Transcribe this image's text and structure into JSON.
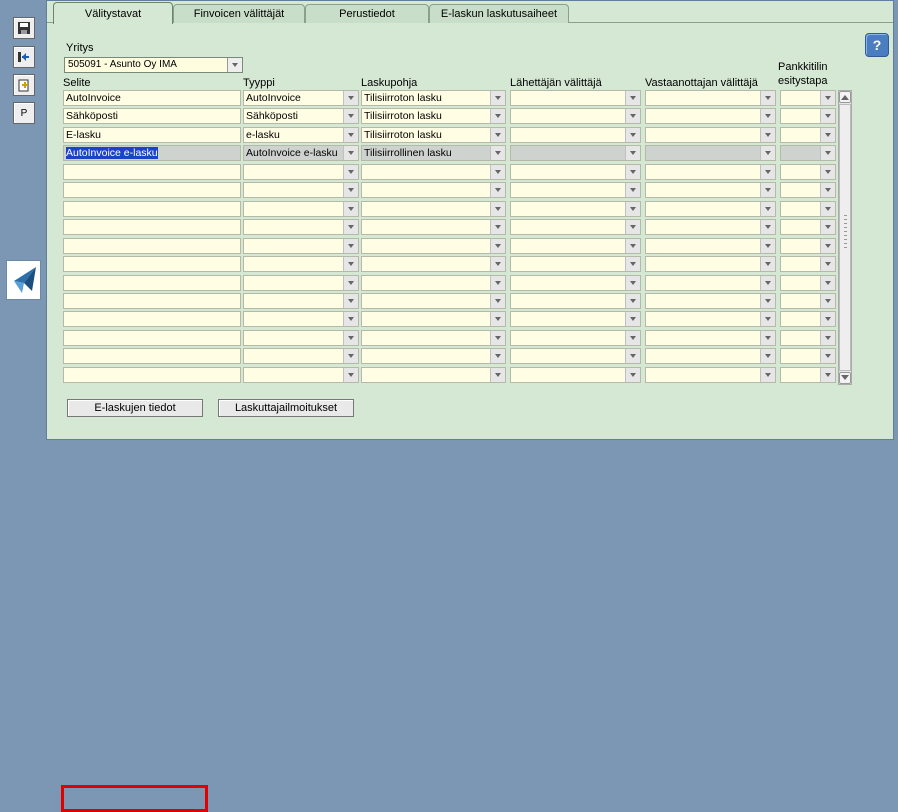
{
  "toolbar": {
    "buttons": [
      {
        "name": "save-icon"
      },
      {
        "name": "exit-icon"
      },
      {
        "name": "new-document-icon"
      },
      {
        "name": "p-button",
        "label": "P"
      }
    ],
    "logo": "app-logo-icon"
  },
  "tabs": [
    {
      "label": "Välitystavat",
      "active": true
    },
    {
      "label": "Finvoicen välittäjät",
      "active": false
    },
    {
      "label": "Perustiedot",
      "active": false
    },
    {
      "label": "E-laskun laskutusaiheet",
      "active": false
    }
  ],
  "help_label": "?",
  "yritys": {
    "label": "Yritys",
    "value": "505091 - Asunto Oy IMA"
  },
  "columns": {
    "selite": "Selite",
    "tyyppi": "Tyyppi",
    "laskupohja": "Laskupohja",
    "lahettaja": "Lähettäjän välittäjä",
    "vastaanottaja": "Vastaanottajan välittäjä",
    "pankkitili_line1": "Pankkitilin",
    "pankkitili_line2": "esitystapa"
  },
  "rows": [
    {
      "selite": "AutoInvoice",
      "tyyppi": "AutoInvoice",
      "laskupohja": "Tilisiirroton lasku",
      "lahettaja": "",
      "vastaanottaja": "",
      "pankkitili": ""
    },
    {
      "selite": "Sähköposti",
      "tyyppi": "Sähköposti",
      "laskupohja": "Tilisiirroton lasku",
      "lahettaja": "",
      "vastaanottaja": "",
      "pankkitili": ""
    },
    {
      "selite": "E-lasku",
      "tyyppi": "e-lasku",
      "laskupohja": "Tilisiirroton lasku",
      "lahettaja": "",
      "vastaanottaja": "",
      "pankkitili": ""
    },
    {
      "selite": "AutoInvoice e-lasku",
      "tyyppi": "AutoInvoice e-lasku",
      "laskupohja": "Tilisiirrollinen lasku",
      "lahettaja": "",
      "vastaanottaja": "",
      "pankkitili": ""
    },
    {
      "selite": "",
      "tyyppi": "",
      "laskupohja": "",
      "lahettaja": "",
      "vastaanottaja": "",
      "pankkitili": ""
    },
    {
      "selite": "",
      "tyyppi": "",
      "laskupohja": "",
      "lahettaja": "",
      "vastaanottaja": "",
      "pankkitili": ""
    },
    {
      "selite": "",
      "tyyppi": "",
      "laskupohja": "",
      "lahettaja": "",
      "vastaanottaja": "",
      "pankkitili": ""
    },
    {
      "selite": "",
      "tyyppi": "",
      "laskupohja": "",
      "lahettaja": "",
      "vastaanottaja": "",
      "pankkitili": ""
    },
    {
      "selite": "",
      "tyyppi": "",
      "laskupohja": "",
      "lahettaja": "",
      "vastaanottaja": "",
      "pankkitili": ""
    },
    {
      "selite": "",
      "tyyppi": "",
      "laskupohja": "",
      "lahettaja": "",
      "vastaanottaja": "",
      "pankkitili": ""
    },
    {
      "selite": "",
      "tyyppi": "",
      "laskupohja": "",
      "lahettaja": "",
      "vastaanottaja": "",
      "pankkitili": ""
    },
    {
      "selite": "",
      "tyyppi": "",
      "laskupohja": "",
      "lahettaja": "",
      "vastaanottaja": "",
      "pankkitili": ""
    },
    {
      "selite": "",
      "tyyppi": "",
      "laskupohja": "",
      "lahettaja": "",
      "vastaanottaja": "",
      "pankkitili": ""
    },
    {
      "selite": "",
      "tyyppi": "",
      "laskupohja": "",
      "lahettaja": "",
      "vastaanottaja": "",
      "pankkitili": ""
    },
    {
      "selite": "",
      "tyyppi": "",
      "laskupohja": "",
      "lahettaja": "",
      "vastaanottaja": "",
      "pankkitili": ""
    },
    {
      "selite": "",
      "tyyppi": "",
      "laskupohja": "",
      "lahettaja": "",
      "vastaanottaja": "",
      "pankkitili": ""
    }
  ],
  "selected_row": 3,
  "buttons": {
    "e_laskujen_tiedot": "E-laskujen tiedot",
    "laskuttajailmoitukset": "Laskuttajailmoitukset"
  },
  "colors": {
    "panel_bg": "#d5e8d4",
    "cell_bg": "#fffde3",
    "frame_bg": "#7b97b3",
    "highlight": "#e00000"
  }
}
